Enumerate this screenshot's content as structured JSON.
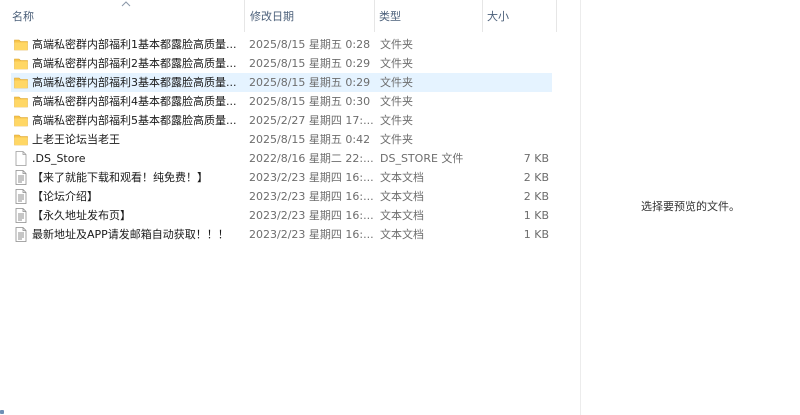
{
  "columns": {
    "name": "名称",
    "date_modified": "修改日期",
    "type": "类型",
    "size": "大小"
  },
  "sort": {
    "column": "name",
    "direction": "ascending",
    "icon": "sort-up-icon"
  },
  "files": [
    {
      "name": "高端私密群内部福利1基本都露脸高质量...",
      "date": "2025/8/15 星期五 0:28",
      "type": "文件夹",
      "size": "",
      "icon": "folder-icon",
      "selected": false
    },
    {
      "name": "高端私密群内部福利2基本都露脸高质量...",
      "date": "2025/8/15 星期五 0:29",
      "type": "文件夹",
      "size": "",
      "icon": "folder-icon",
      "selected": false
    },
    {
      "name": "高端私密群内部福利3基本都露脸高质量...",
      "date": "2025/8/15 星期五 0:29",
      "type": "文件夹",
      "size": "",
      "icon": "folder-icon",
      "selected": true
    },
    {
      "name": "高端私密群内部福利4基本都露脸高质量...",
      "date": "2025/8/15 星期五 0:30",
      "type": "文件夹",
      "size": "",
      "icon": "folder-icon",
      "selected": false
    },
    {
      "name": "高端私密群内部福利5基本都露脸高质量...",
      "date": "2025/2/27 星期四 17:...",
      "type": "文件夹",
      "size": "",
      "icon": "folder-icon",
      "selected": false
    },
    {
      "name": "上老王论坛当老王",
      "date": "2025/8/15 星期五 0:42",
      "type": "文件夹",
      "size": "",
      "icon": "folder-icon",
      "selected": false
    },
    {
      "name": ".DS_Store",
      "date": "2022/8/16 星期二 22:...",
      "type": "DS_STORE 文件",
      "size": "7 KB",
      "icon": "blank-file-icon",
      "selected": false
    },
    {
      "name": "【来了就能下载和观看！纯免费！】",
      "date": "2023/2/23 星期四 16:...",
      "type": "文本文档",
      "size": "2 KB",
      "icon": "text-file-icon",
      "selected": false
    },
    {
      "name": "【论坛介绍】",
      "date": "2023/2/23 星期四 16:...",
      "type": "文本文档",
      "size": "2 KB",
      "icon": "text-file-icon",
      "selected": false
    },
    {
      "name": "【永久地址发布页】",
      "date": "2023/2/23 星期四 16:...",
      "type": "文本文档",
      "size": "1 KB",
      "icon": "text-file-icon",
      "selected": false
    },
    {
      "name": "最新地址及APP请发邮箱自动获取！！！",
      "date": "2023/2/23 星期四 16:...",
      "type": "文本文档",
      "size": "1 KB",
      "icon": "text-file-icon",
      "selected": false
    }
  ],
  "preview": {
    "message": "选择要预览的文件。"
  },
  "colors": {
    "selection": "#e5f3ff",
    "folder": "#f8c54a",
    "header_text": "#4c607a",
    "secondary_text": "#6d6d6d"
  }
}
